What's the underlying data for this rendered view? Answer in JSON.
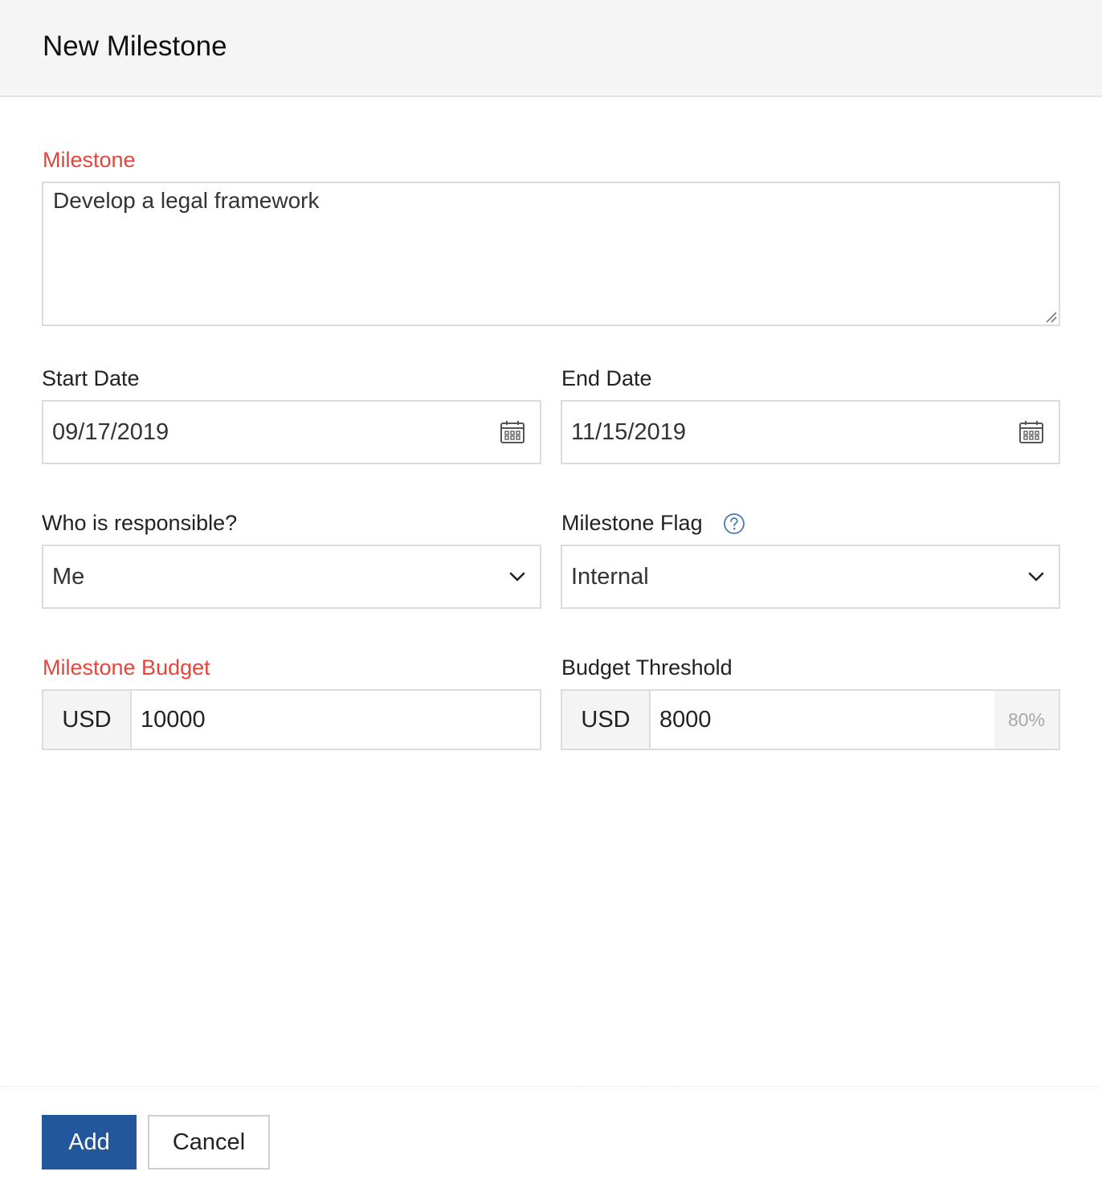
{
  "header": {
    "title": "New Milestone"
  },
  "form": {
    "milestone": {
      "label": "Milestone",
      "value": "Develop a legal framework"
    },
    "start_date": {
      "label": "Start Date",
      "value": "09/17/2019"
    },
    "end_date": {
      "label": "End Date",
      "value": "11/15/2019"
    },
    "responsible": {
      "label": "Who is responsible?",
      "value": "Me"
    },
    "flag": {
      "label": "Milestone Flag",
      "value": "Internal"
    },
    "budget": {
      "label": "Milestone Budget",
      "currency": "USD",
      "value": "10000"
    },
    "threshold": {
      "label": "Budget Threshold",
      "currency": "USD",
      "value": "8000",
      "percent": "80%"
    }
  },
  "footer": {
    "add_label": "Add",
    "cancel_label": "Cancel"
  },
  "colors": {
    "required": "#e5453a",
    "primary": "#22579b",
    "help": "#4a7ab8"
  }
}
